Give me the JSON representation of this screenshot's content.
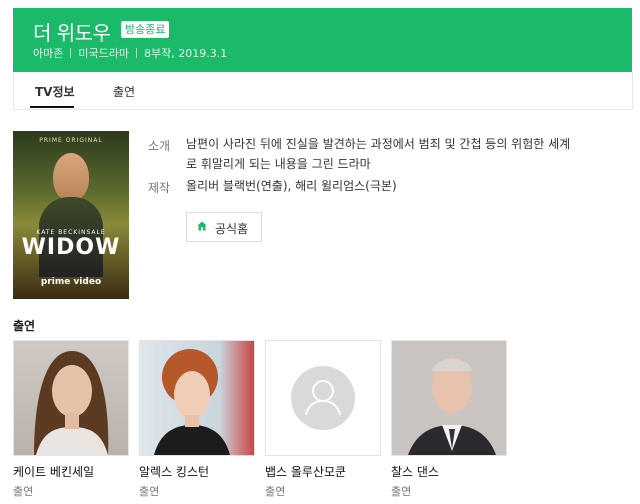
{
  "header": {
    "title": "더 위도우",
    "badge": "방송종료",
    "meta": [
      "아마존",
      "미국드라마",
      "8부작, 2019.3.1"
    ]
  },
  "tabs": [
    {
      "label": "TV정보",
      "active": true
    },
    {
      "label": "출연",
      "active": false
    }
  ],
  "poster": {
    "top_text": "PRIME ORIGINAL",
    "actor_text": "KATE BECKINSALE",
    "show_text": "WIDOW",
    "bottom_text": "prime video"
  },
  "info": {
    "synopsis_label": "소개",
    "synopsis_line1": "남편이 사라진 뒤에 진실을 발견하는 과정에서 범죄 및 간첩 등의 위험한 세계",
    "synopsis_line2": "로 휘말리게 되는 내용을 그린 드라마",
    "production_label": "제작",
    "production_text": "올리버 블랙번(연출), 해리 윌리엄스(극본)",
    "home_button": "공식홈"
  },
  "cast": {
    "title": "출연",
    "members": [
      {
        "name": "케이트 베킨세일",
        "role": "출연"
      },
      {
        "name": "알렉스 킹스턴",
        "role": "출연"
      },
      {
        "name": "뱁스 올루산모쿤",
        "role": "출연"
      },
      {
        "name": "찰스 댄스",
        "role": "출연"
      }
    ]
  },
  "colors": {
    "brand_green": "#1aba68"
  }
}
